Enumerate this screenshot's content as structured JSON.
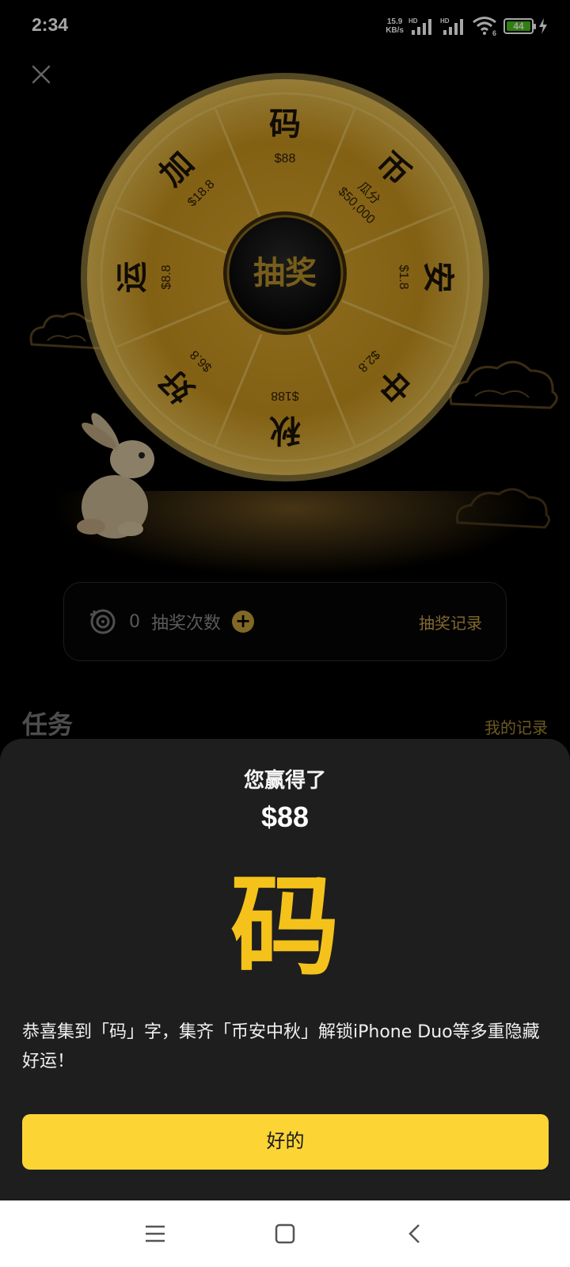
{
  "status_bar": {
    "time": "2:34",
    "net_speed_value": "15.9",
    "net_speed_unit": "KB/s",
    "signal_1_label": "HD",
    "signal_2_label": "HD",
    "wifi_label": "6",
    "battery_level": "44"
  },
  "wheel": {
    "center_label": "抽奖",
    "segments": [
      {
        "char": "码",
        "amount": "$88"
      },
      {
        "char": "币",
        "amount": "$50,000",
        "note": "瓜分"
      },
      {
        "char": "安",
        "amount": "$1.8"
      },
      {
        "char": "中",
        "amount": "$2.8"
      },
      {
        "char": "秋",
        "amount": "$188"
      },
      {
        "char": "好",
        "amount": "$6.8"
      },
      {
        "char": "运",
        "amount": "$8.8"
      },
      {
        "char": "加",
        "amount": "$18.8"
      }
    ]
  },
  "lottery": {
    "count": "0",
    "label": "抽奖次数",
    "plus": "+",
    "record_link": "抽奖记录"
  },
  "tasks": {
    "title": "任务",
    "my_record": "我的记录"
  },
  "sheet": {
    "title": "您赢得了",
    "amount": "$88",
    "character": "码",
    "description": "恭喜集到「码」字，集齐「币安中秋」解锁iPhone Duo等多重隐藏好运！",
    "ok_button": "好的"
  },
  "icons": {
    "close": "close-icon",
    "draw": "draw-refresh-icon",
    "nav_menu": "menu-icon",
    "nav_home": "home-square-icon",
    "nav_back": "back-chevron-icon"
  },
  "colors": {
    "accent": "#fcd535",
    "gold_text": "#c7a046",
    "big_char": "#f4c21a",
    "sheet_bg": "#1e1e1e"
  }
}
